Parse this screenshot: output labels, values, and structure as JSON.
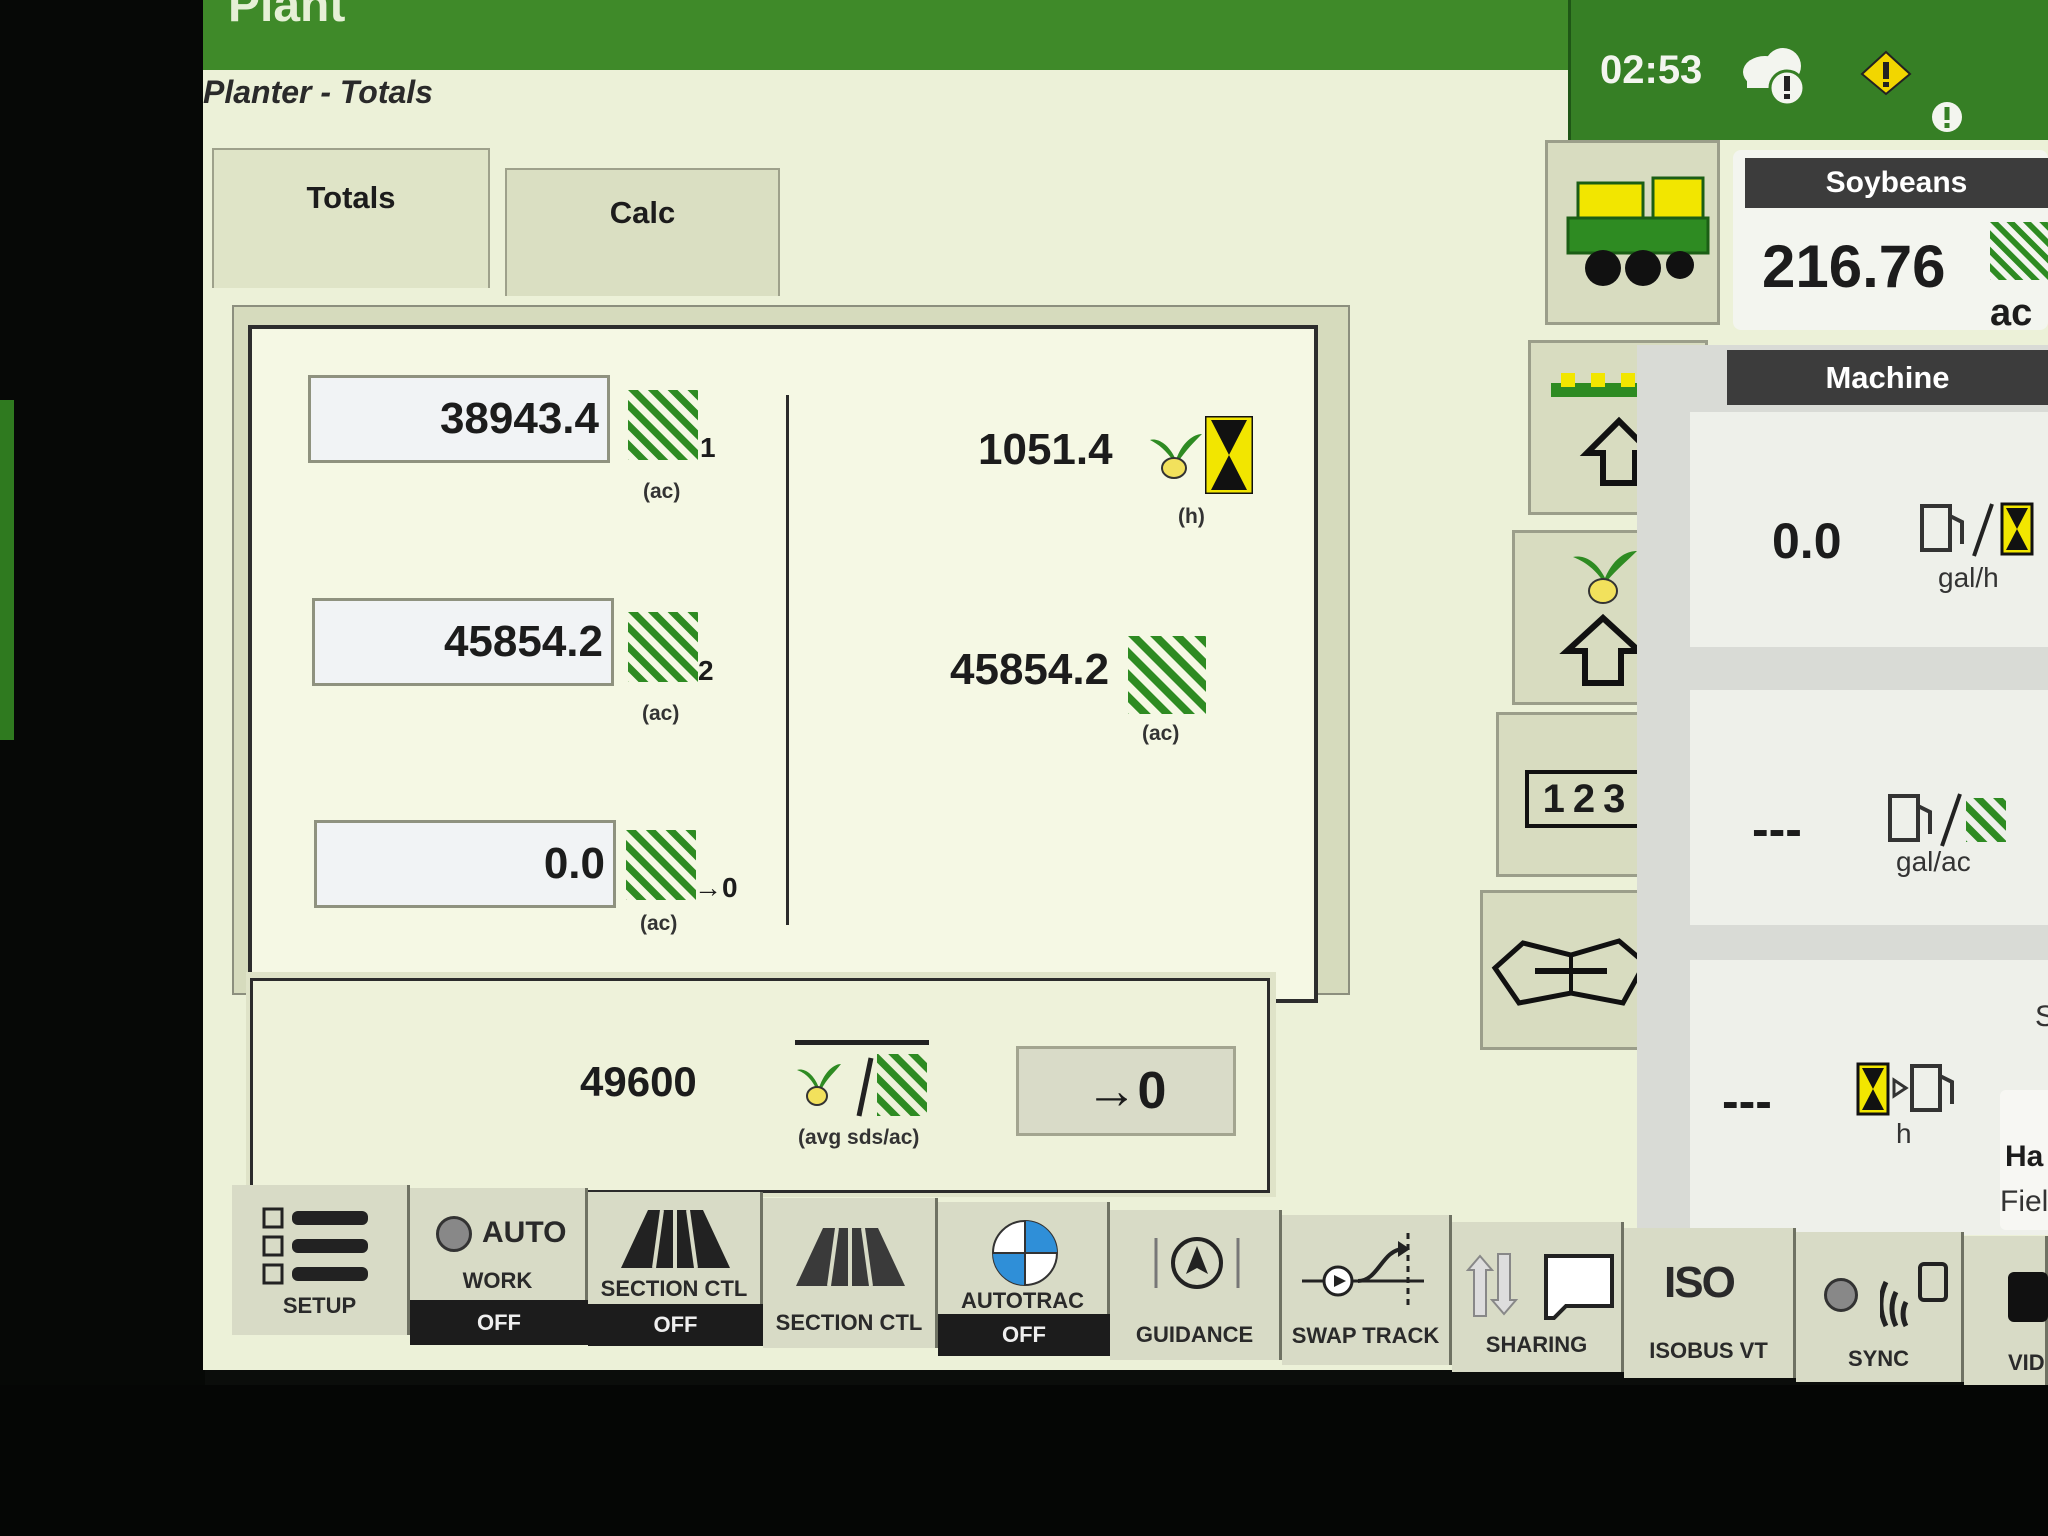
{
  "header": {
    "app_title": "Plant",
    "page_title": "Planter - Totals",
    "clock": "02:53"
  },
  "tabs": [
    {
      "label": "Totals",
      "selected": true
    },
    {
      "label": "Calc",
      "selected": false
    }
  ],
  "totals": {
    "counters": [
      {
        "value": "38943.4",
        "sub": "1",
        "unit": "(ac)"
      },
      {
        "value": "45854.2",
        "sub": "2",
        "unit": "(ac)"
      },
      {
        "value": "0.0",
        "sub": "→0",
        "unit": "(ac)"
      }
    ],
    "right": [
      {
        "value": "1051.4",
        "unit": "(h)",
        "icon": "seed-hourglass-icon"
      },
      {
        "value": "45854.2",
        "unit": "(ac)",
        "icon": "area-icon"
      }
    ]
  },
  "rate": {
    "value": "49600",
    "unit": "(avg sds/ac)",
    "reset_label": "→0"
  },
  "crop_panel": {
    "title": "Soybeans",
    "value": "216.76",
    "unit": "ac"
  },
  "machine_panel": {
    "title": "Machine",
    "rows": [
      {
        "value": "0.0",
        "unit": "gal/h"
      },
      {
        "value": "---",
        "unit": "gal/ac"
      },
      {
        "value": "---",
        "unit": "h"
      }
    ],
    "partial_tile": {
      "line1": "Ha",
      "line2": "Fiel",
      "side": "S"
    }
  },
  "side_buttons": {
    "numbers": "123"
  },
  "toolbar": [
    {
      "label": "SETUP",
      "state": ""
    },
    {
      "label": "WORK",
      "top": "AUTO",
      "state": "OFF"
    },
    {
      "label": "SECTION CTL",
      "state": "OFF"
    },
    {
      "label": "SECTION CTL",
      "state": ""
    },
    {
      "label": "AUTOTRAC",
      "state": "OFF"
    },
    {
      "label": "GUIDANCE",
      "state": ""
    },
    {
      "label": "SWAP TRACK",
      "state": ""
    },
    {
      "label": "SHARING",
      "state": ""
    },
    {
      "label": "ISOBUS VT",
      "icon_text": "ISO",
      "state": ""
    },
    {
      "label": "SYNC",
      "state": ""
    },
    {
      "label": "VID",
      "state": ""
    }
  ],
  "colors": {
    "jd_green": "#3f8a29",
    "stripe_green": "#2e8b22",
    "jd_yellow": "#f2e600",
    "screen_bg": "#ecf1d8"
  }
}
